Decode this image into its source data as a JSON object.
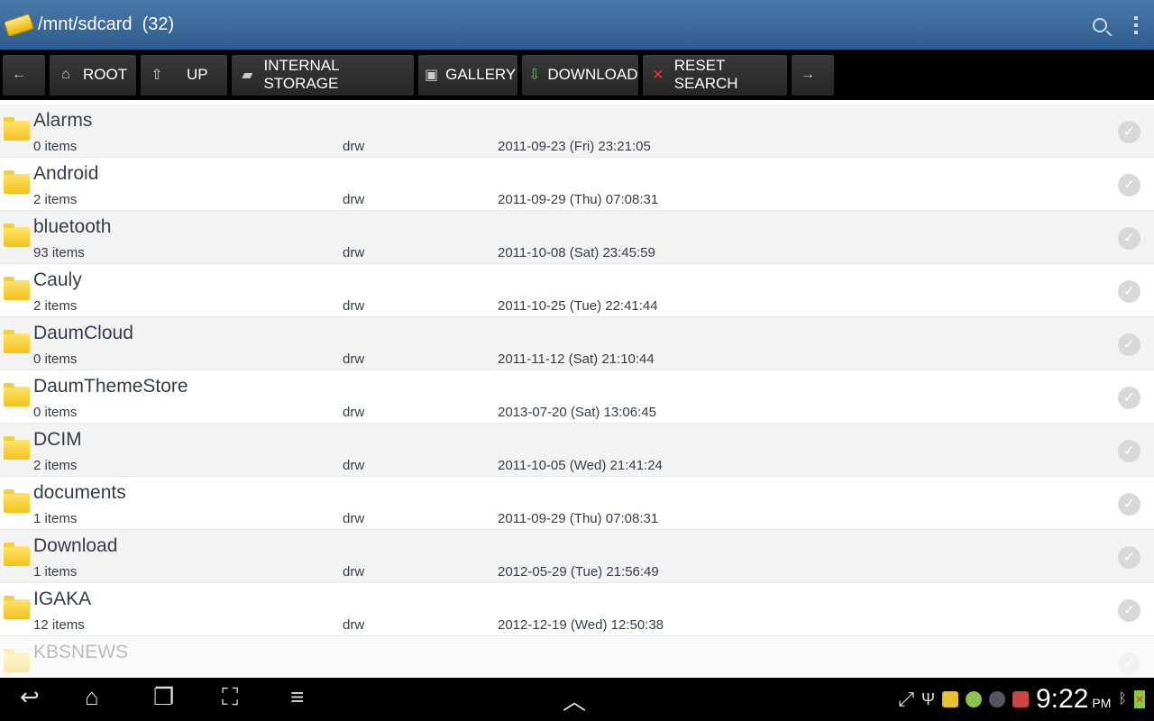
{
  "header": {
    "title": "/mnt/sdcard  (32)",
    "app_icon": "folder-open-icon",
    "actions": [
      "search-icon",
      "overflow-menu-icon"
    ]
  },
  "toolbar": {
    "buttons": [
      {
        "icon": "←",
        "label": ""
      },
      {
        "icon": "⌂",
        "label": "ROOT"
      },
      {
        "icon": "⇧",
        "label": "UP"
      },
      {
        "icon": "▰",
        "label": "INTERNAL STORAGE"
      },
      {
        "icon": "▣",
        "label": "GALLERY"
      },
      {
        "icon": "⇩",
        "label": "DOWNLOAD"
      },
      {
        "icon": "✕",
        "label": "RESET SEARCH"
      },
      {
        "icon": "→",
        "label": ""
      }
    ]
  },
  "files": [
    {
      "name": "Alarms",
      "count": "0 items",
      "perm": "drw",
      "date": "2011-09-23 (Fri) 23:21:05"
    },
    {
      "name": "Android",
      "count": "2 items",
      "perm": "drw",
      "date": "2011-09-29 (Thu) 07:08:31"
    },
    {
      "name": "bluetooth",
      "count": "93 items",
      "perm": "drw",
      "date": "2011-10-08 (Sat) 23:45:59"
    },
    {
      "name": "Cauly",
      "count": "2 items",
      "perm": "drw",
      "date": "2011-10-25 (Tue) 22:41:44"
    },
    {
      "name": "DaumCloud",
      "count": "0 items",
      "perm": "drw",
      "date": "2011-11-12 (Sat) 21:10:44"
    },
    {
      "name": "DaumThemeStore",
      "count": "0 items",
      "perm": "drw",
      "date": "2013-07-20 (Sat) 13:06:45"
    },
    {
      "name": "DCIM",
      "count": "2 items",
      "perm": "drw",
      "date": "2011-10-05 (Wed) 21:41:24"
    },
    {
      "name": "documents",
      "count": "1 items",
      "perm": "drw",
      "date": "2011-09-29 (Thu) 07:08:31"
    },
    {
      "name": "Download",
      "count": "1 items",
      "perm": "drw",
      "date": "2012-05-29 (Tue) 21:56:49"
    },
    {
      "name": "IGAKA",
      "count": "12 items",
      "perm": "drw",
      "date": "2012-12-19 (Wed) 12:50:38"
    },
    {
      "name": "KBSNEWS",
      "count": "",
      "perm": "",
      "date": ""
    }
  ],
  "statusbar": {
    "time": "9:22",
    "ampm": "PM"
  },
  "colors": {
    "title_bar": "#3a6a9c",
    "toolbar": "#000000",
    "row_alt": "#f3f3f3",
    "text": "#333d4a"
  }
}
